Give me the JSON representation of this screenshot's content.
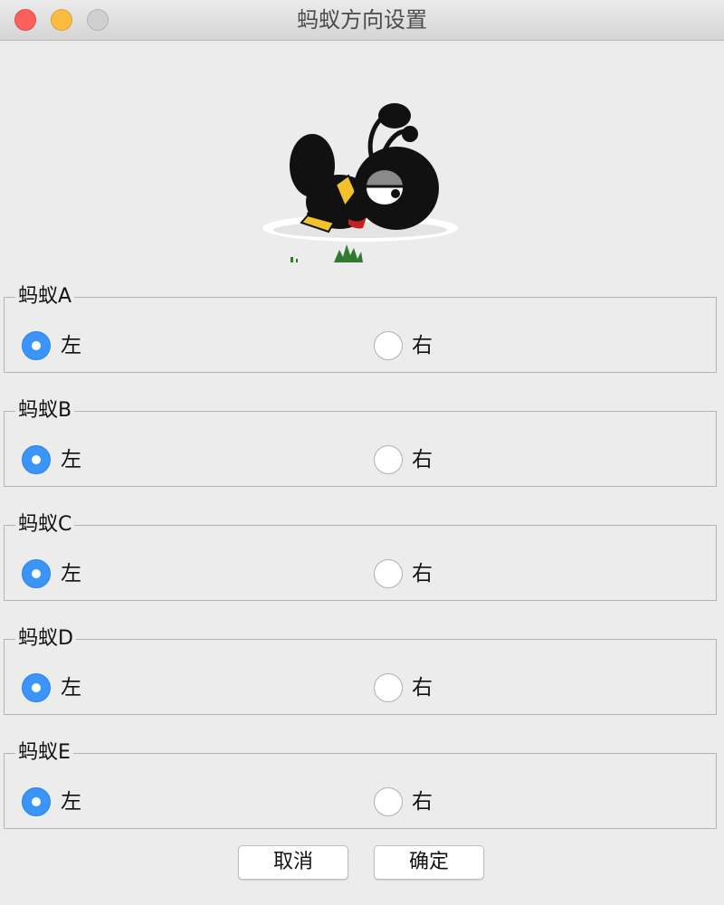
{
  "window": {
    "title": "蚂蚁方向设置"
  },
  "groups": [
    {
      "label": "蚂蚁A",
      "left_label": "左",
      "right_label": "右",
      "selected": "left"
    },
    {
      "label": "蚂蚁B",
      "left_label": "左",
      "right_label": "右",
      "selected": "left"
    },
    {
      "label": "蚂蚁C",
      "left_label": "左",
      "right_label": "右",
      "selected": "left"
    },
    {
      "label": "蚂蚁D",
      "left_label": "左",
      "right_label": "右",
      "selected": "left"
    },
    {
      "label": "蚂蚁E",
      "left_label": "左",
      "right_label": "右",
      "selected": "left"
    }
  ],
  "buttons": {
    "cancel": "取消",
    "confirm": "确定"
  },
  "colors": {
    "accent": "#3b95f8",
    "close": "#fc605c",
    "minimize": "#fdbc40",
    "zoom_disabled": "#d0d0d0"
  }
}
